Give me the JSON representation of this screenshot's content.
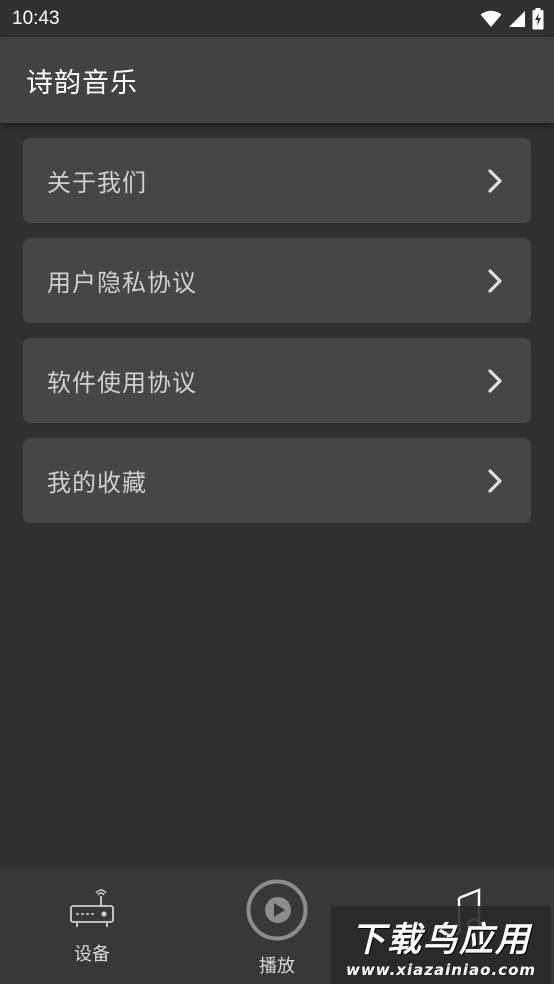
{
  "status_bar": {
    "time": "10:43",
    "icons": [
      "wifi-icon",
      "cellular-signal-icon",
      "battery-charging-icon"
    ]
  },
  "app_bar": {
    "title": "诗韵音乐"
  },
  "menu": {
    "items": [
      {
        "label": "关于我们",
        "icon": "chevron-right-icon"
      },
      {
        "label": "用户隐私协议",
        "icon": "chevron-right-icon"
      },
      {
        "label": "软件使用协议",
        "icon": "chevron-right-icon"
      },
      {
        "label": "我的收藏",
        "icon": "chevron-right-icon"
      }
    ]
  },
  "bottom_nav": {
    "items": [
      {
        "label": "设备",
        "icon": "router-device-icon"
      },
      {
        "label": "播放",
        "icon": "play-circle-icon"
      },
      {
        "label": "",
        "icon": "music-note-icon"
      }
    ]
  },
  "watermark": {
    "main": "下载鸟应用",
    "sub": "www.xiazainiao.com"
  },
  "colors": {
    "background": "#303030",
    "app_bar": "#424242",
    "menu_item": "#464646",
    "bottom_nav": "#383838",
    "text": "#d0d0d0"
  }
}
